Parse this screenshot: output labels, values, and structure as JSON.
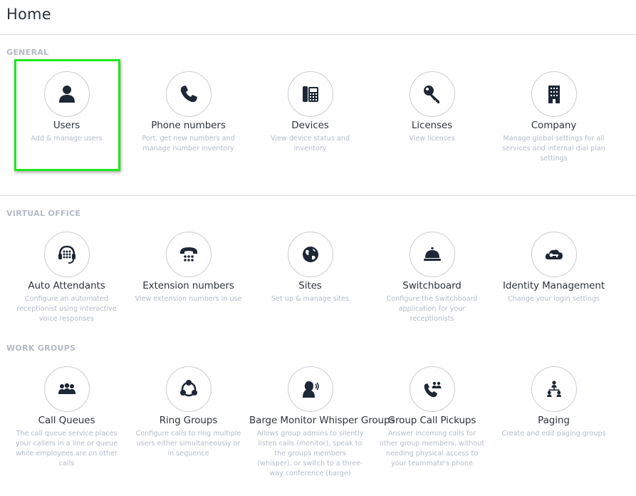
{
  "page": {
    "title": "Home"
  },
  "colors": {
    "accent_highlight": "#22e51d",
    "icon": "#1e2735",
    "section_title": "#b3bac4",
    "desc": "#b4bcc7"
  },
  "sections": [
    {
      "title": "GENERAL",
      "tiles": [
        {
          "title": "Users",
          "desc": "Add & manage users",
          "icon": "user-icon"
        },
        {
          "title": "Phone numbers",
          "desc": "Port, get new numbers and manage number inventory",
          "icon": "phone-icon"
        },
        {
          "title": "Devices",
          "desc": "View device status and inventory",
          "icon": "desk-phone-icon"
        },
        {
          "title": "Licenses",
          "desc": "View licenses",
          "icon": "key-icon"
        },
        {
          "title": "Company",
          "desc": "Manage global settings for all services and internal dial plan settings",
          "icon": "building-icon"
        }
      ]
    },
    {
      "title": "VIRTUAL OFFICE",
      "tiles": [
        {
          "title": "Auto Attendants",
          "desc": "Configure an automated receptionist using interactive voice responses",
          "icon": "headset-keypad-icon"
        },
        {
          "title": "Extension numbers",
          "desc": "View extension numbers in use",
          "icon": "rotary-phone-icon"
        },
        {
          "title": "Sites",
          "desc": "Set up & manage sites",
          "icon": "globe-icon"
        },
        {
          "title": "Switchboard",
          "desc": "Configure the Switchboard application for your receptionists",
          "icon": "service-bell-icon"
        },
        {
          "title": "Identity Management",
          "desc": "Change your login settings",
          "icon": "cloud-key-icon"
        }
      ]
    },
    {
      "title": "WORK GROUPS",
      "tiles": [
        {
          "title": "Call Queues",
          "desc": "The call queue service places your callers in a line or queue while employees are on other calls",
          "icon": "group-queue-icon"
        },
        {
          "title": "Ring Groups",
          "desc": "Configure calls to ring multiple users either simultaneously or in sequence",
          "icon": "ring-group-icon"
        },
        {
          "title": "Barge Monitor Whisper Groups",
          "desc": "Allows group admins to silently listen calls (monitor), speak to the groups members (whisper), or switch to a three-way conference (barge)",
          "icon": "speaking-head-icon"
        },
        {
          "title": "Group Call Pickups",
          "desc": "Answer incoming calls for other group members, without needing physical access to your teammate's phone",
          "icon": "phone-group-icon"
        },
        {
          "title": "Paging",
          "desc": "Create and edit paging groups",
          "icon": "org-chart-icon"
        }
      ]
    }
  ]
}
